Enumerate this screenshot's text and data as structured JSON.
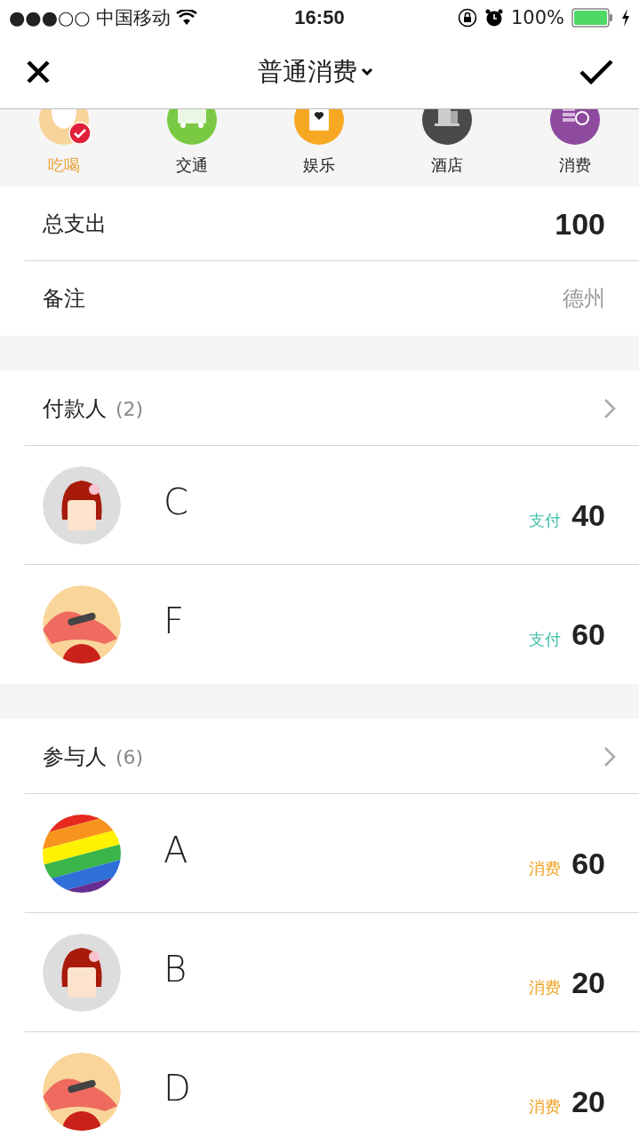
{
  "status_bar": {
    "signal": "●●●○○",
    "carrier": "中国移动",
    "time": "16:50",
    "battery": "100%"
  },
  "nav": {
    "title": "普通消费"
  },
  "categories": [
    {
      "label": "吃喝",
      "kind": "food",
      "selected": true
    },
    {
      "label": "交通",
      "kind": "transport",
      "selected": false
    },
    {
      "label": "娱乐",
      "kind": "entertainment",
      "selected": false
    },
    {
      "label": "酒店",
      "kind": "hotel",
      "selected": false
    },
    {
      "label": "消费",
      "kind": "shopping",
      "selected": false
    }
  ],
  "total": {
    "label": "总支出",
    "value": "100"
  },
  "note": {
    "label": "备注",
    "value": "德州"
  },
  "payers": {
    "title": "付款人",
    "count": "(2)",
    "people": [
      {
        "name": "C",
        "avatar": {
          "kind": "girl"
        },
        "kind": "pay",
        "action": "支付",
        "amount": "40"
      },
      {
        "name": "F",
        "avatar": {
          "kind": "horse"
        },
        "kind": "pay",
        "action": "支付",
        "amount": "60"
      }
    ]
  },
  "participants": {
    "title": "参与人",
    "count": "(6)",
    "people": [
      {
        "name": "A",
        "avatar": {
          "kind": "rainbow"
        },
        "kind": "spend",
        "action": "消费",
        "amount": "60"
      },
      {
        "name": "B",
        "avatar": {
          "kind": "girl"
        },
        "kind": "spend",
        "action": "消费",
        "amount": "20"
      },
      {
        "name": "D",
        "avatar": {
          "kind": "horse"
        },
        "kind": "spend",
        "action": "消费",
        "amount": "20"
      }
    ]
  }
}
